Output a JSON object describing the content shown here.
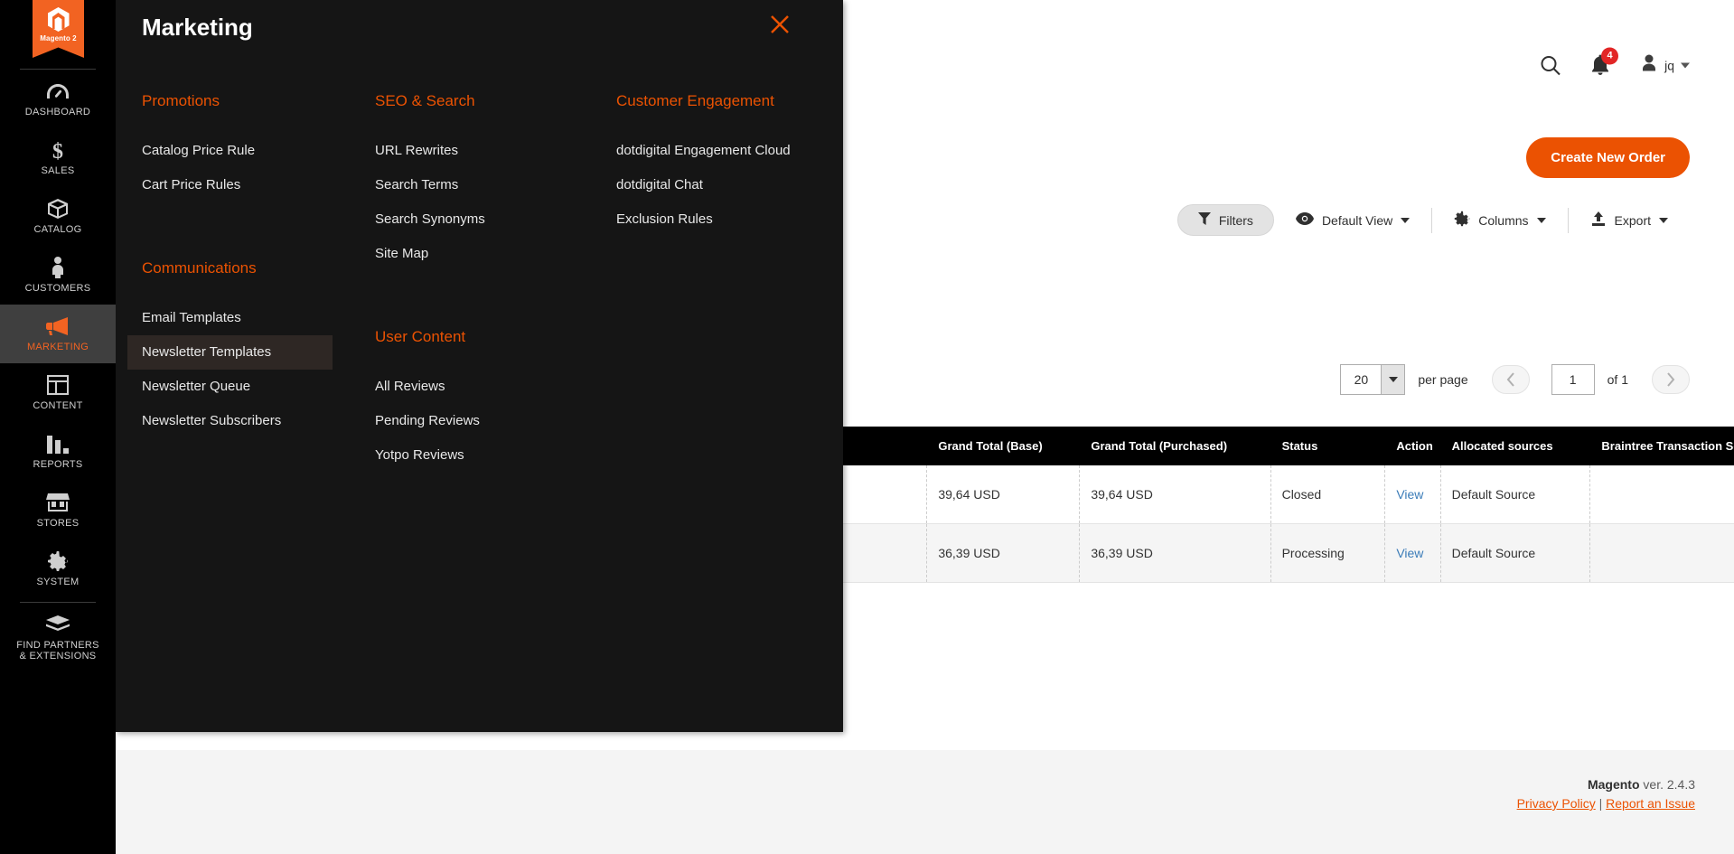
{
  "sidebar": {
    "logo": {
      "name": "Magento 2",
      "icon": "magento-logo-icon"
    },
    "items": [
      {
        "label": "DASHBOARD",
        "icon": "dashboard-icon",
        "active": false
      },
      {
        "label": "SALES",
        "icon": "dollar-icon",
        "active": false
      },
      {
        "label": "CATALOG",
        "icon": "box-icon",
        "active": false
      },
      {
        "label": "CUSTOMERS",
        "icon": "person-icon",
        "active": false
      },
      {
        "label": "MARKETING",
        "icon": "megaphone-icon",
        "active": true
      },
      {
        "label": "CONTENT",
        "icon": "layout-icon",
        "active": false
      },
      {
        "label": "REPORTS",
        "icon": "bar-chart-icon",
        "active": false
      },
      {
        "label": "STORES",
        "icon": "storefront-icon",
        "active": false
      },
      {
        "label": "SYSTEM",
        "icon": "gear-icon",
        "active": false
      },
      {
        "label": "FIND PARTNERS\n& EXTENSIONS",
        "label_line1": "FIND PARTNERS",
        "label_line2": "& EXTENSIONS",
        "icon": "extension-box-icon",
        "active": false
      }
    ]
  },
  "header": {
    "search_icon": "search-icon",
    "notifications": {
      "icon": "bell-icon",
      "count": "4"
    },
    "user": {
      "icon": "avatar-icon",
      "name": "jq"
    }
  },
  "megamenu": {
    "title": "Marketing",
    "close_icon": "close-icon",
    "columns": [
      {
        "groups": [
          {
            "heading": "Promotions",
            "items": [
              {
                "label": "Catalog Price Rule",
                "selected": false
              },
              {
                "label": "Cart Price Rules",
                "selected": false
              }
            ]
          },
          {
            "heading": "Communications",
            "spaced": true,
            "items": [
              {
                "label": "Email Templates",
                "selected": false
              },
              {
                "label": "Newsletter Templates",
                "selected": true
              },
              {
                "label": "Newsletter Queue",
                "selected": false
              },
              {
                "label": "Newsletter Subscribers",
                "selected": false
              }
            ]
          }
        ]
      },
      {
        "groups": [
          {
            "heading": "SEO & Search",
            "items": [
              {
                "label": "URL Rewrites",
                "selected": false
              },
              {
                "label": "Search Terms",
                "selected": false
              },
              {
                "label": "Search Synonyms",
                "selected": false
              },
              {
                "label": "Site Map",
                "selected": false
              }
            ]
          },
          {
            "heading": "User Content",
            "spaced": true,
            "items": [
              {
                "label": "All Reviews",
                "selected": false
              },
              {
                "label": "Pending Reviews",
                "selected": false
              },
              {
                "label": "Yotpo Reviews",
                "selected": false
              }
            ]
          }
        ]
      },
      {
        "groups": [
          {
            "heading": "Customer Engagement",
            "items": [
              {
                "label": "dotdigital Engagement Cloud",
                "selected": false
              },
              {
                "label": "dotdigital Chat",
                "selected": false
              },
              {
                "label": "Exclusion Rules",
                "selected": false
              }
            ]
          }
        ]
      }
    ]
  },
  "main": {
    "create_order_label": "Create New Order",
    "toolbar": {
      "filters_label": "Filters",
      "filters_icon": "funnel-icon",
      "view_label": "Default View",
      "view_icon": "eye-icon",
      "columns_label": "Columns",
      "columns_icon": "gear-icon",
      "export_label": "Export",
      "export_icon": "upload-icon"
    },
    "pager": {
      "per_page_value": "20",
      "per_page_label": "per page",
      "prev_icon": "chevron-left-icon",
      "next_icon": "chevron-right-icon",
      "page_value": "1",
      "of_label": "of 1"
    },
    "table": {
      "columns": [
        "Grand Total (Base)",
        "Grand Total (Purchased)",
        "Status",
        "Action",
        "Allocated sources",
        "Braintree Transaction Source"
      ],
      "rows": [
        {
          "grand_total_base": "39,64 USD",
          "grand_total_purchased": "39,64 USD",
          "status": "Closed",
          "action": "View",
          "allocated_sources": "Default Source",
          "braintree_transaction_source": ""
        },
        {
          "grand_total_base": "36,39 USD",
          "grand_total_purchased": "36,39 USD",
          "status": "Processing",
          "action": "View",
          "allocated_sources": "Default Source",
          "braintree_transaction_source": ""
        }
      ]
    }
  },
  "footer": {
    "brand": "Magento",
    "version": " ver. 2.4.3",
    "privacy_label": "Privacy Policy",
    "separator": " | ",
    "report_label": "Report an Issue"
  },
  "colors": {
    "accent": "#eb5202",
    "sidebar_bg": "#000000",
    "panel_bg": "#151515",
    "badge_red": "#e22626",
    "link_blue": "#3b7cb8"
  }
}
